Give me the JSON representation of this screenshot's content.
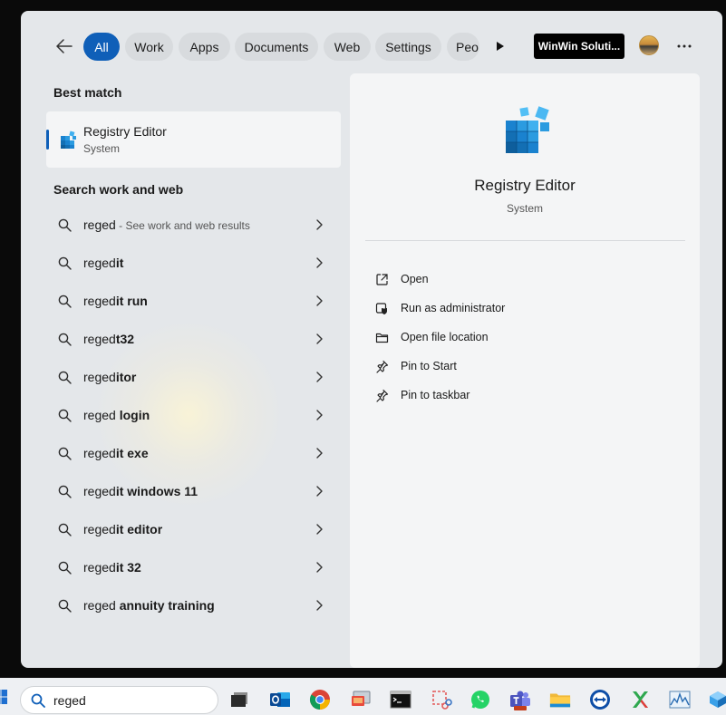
{
  "filters": {
    "back_icon": "arrow-left-icon",
    "chips": [
      "All",
      "Work",
      "Apps",
      "Documents",
      "Web",
      "Settings",
      "Peo"
    ],
    "more_icon": "play-right-icon",
    "org_label": "WinWin Soluti...",
    "overflow_icon": "ellipsis-icon",
    "accent": "#0f5fb8"
  },
  "best_match": {
    "heading": "Best match",
    "title": "Registry Editor",
    "subtitle": "System",
    "icon": "registry-editor-icon"
  },
  "suggestions_heading": "Search work and web",
  "suggestions": [
    {
      "prefix": "reged",
      "bold": "",
      "hint": " - See work and web results"
    },
    {
      "prefix": "reged",
      "bold": "it",
      "hint": ""
    },
    {
      "prefix": "reged",
      "bold": "it run",
      "hint": ""
    },
    {
      "prefix": "reged",
      "bold": "t32",
      "hint": ""
    },
    {
      "prefix": "reged",
      "bold": "itor",
      "hint": ""
    },
    {
      "prefix": "reged",
      "bold": " login",
      "hint": ""
    },
    {
      "prefix": "reged",
      "bold": "it exe",
      "hint": ""
    },
    {
      "prefix": "reged",
      "bold": "it windows 11",
      "hint": ""
    },
    {
      "prefix": "reged",
      "bold": "it editor",
      "hint": ""
    },
    {
      "prefix": "reged",
      "bold": "it 32",
      "hint": ""
    },
    {
      "prefix": "reged",
      "bold": " annuity training",
      "hint": ""
    }
  ],
  "preview": {
    "title": "Registry Editor",
    "subtitle": "System",
    "actions": [
      {
        "label": "Open",
        "icon": "open-external-icon"
      },
      {
        "label": "Run as administrator",
        "icon": "shield-admin-icon"
      },
      {
        "label": "Open file location",
        "icon": "folder-icon"
      },
      {
        "label": "Pin to Start",
        "icon": "pin-icon"
      },
      {
        "label": "Pin to taskbar",
        "icon": "pin-icon"
      }
    ]
  },
  "taskbar": {
    "search_value": "reged",
    "apps": [
      "task-view-icon",
      "outlook-icon",
      "chrome-icon",
      "remote-desktop-icon",
      "command-prompt-icon",
      "snipping-tool-icon",
      "whatsapp-icon",
      "teams-icon",
      "file-explorer-icon",
      "teamviewer-icon",
      "app-x-icon",
      "resource-monitor-icon",
      "box-app-icon"
    ]
  }
}
